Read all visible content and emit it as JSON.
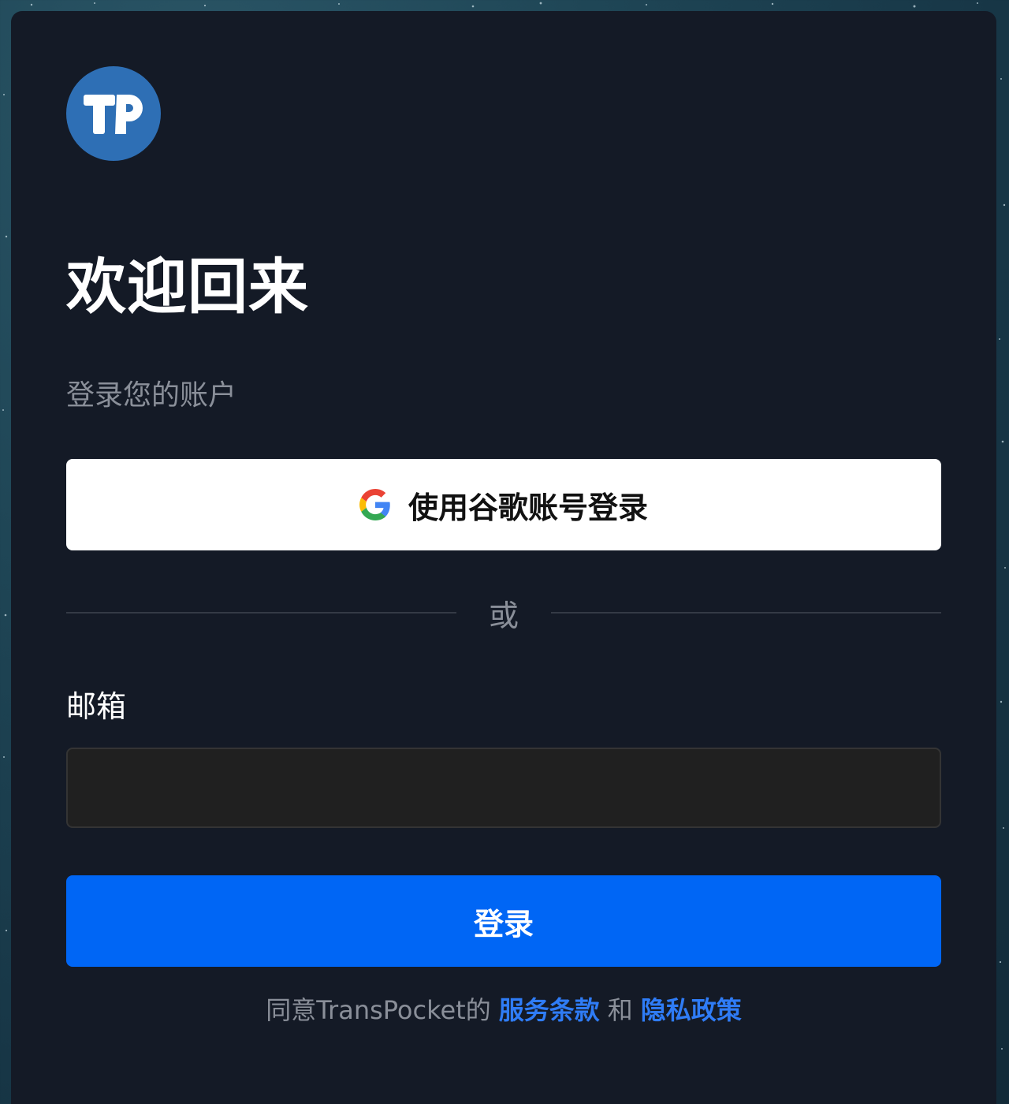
{
  "logo": {
    "text": "TP",
    "bg_color": "#2e6fb5"
  },
  "title": "欢迎回来",
  "subtitle": "登录您的账户",
  "google_button": {
    "label": "使用谷歌账号登录",
    "icon": "google-icon"
  },
  "divider": {
    "text": "或"
  },
  "email": {
    "label": "邮箱",
    "value": ""
  },
  "login_button": {
    "label": "登录",
    "color": "#0066f5"
  },
  "terms": {
    "prefix": "同意TransPocket的",
    "terms_link": "服务条款",
    "conjunction": "和",
    "privacy_link": "隐私政策",
    "link_color": "#2f7cf6"
  },
  "colors": {
    "card_bg": "#141a26",
    "background": "#1f4656"
  }
}
